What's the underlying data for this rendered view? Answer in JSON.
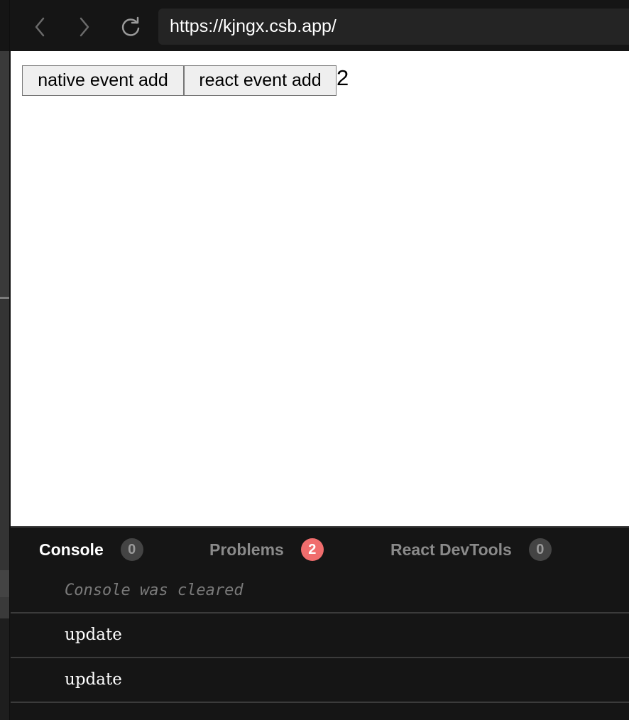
{
  "browser": {
    "url": "https://kjngx.csb.app/",
    "back_icon": "chevron-left-icon",
    "forward_icon": "chevron-right-icon",
    "refresh_icon": "refresh-icon"
  },
  "page": {
    "buttons": [
      {
        "label": "native event add"
      },
      {
        "label": "react event add"
      }
    ],
    "count": "2"
  },
  "devtools": {
    "tabs": [
      {
        "label": "Console",
        "badge": "0",
        "active": true
      },
      {
        "label": "Problems",
        "badge": "2",
        "active": false,
        "badge_color": "#f06d6d"
      },
      {
        "label": "React DevTools",
        "badge": "0",
        "active": false
      }
    ],
    "console": {
      "cleared_message": "Console was cleared",
      "logs": [
        "update",
        "update"
      ]
    }
  },
  "colors": {
    "toolbar_bg": "#151515",
    "url_bar_bg": "#242424",
    "devtools_bg": "#151515",
    "alert_badge": "#f06d6d"
  }
}
